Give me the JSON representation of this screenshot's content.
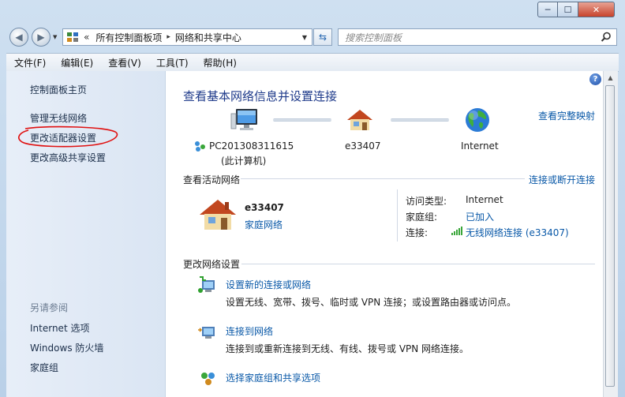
{
  "window": {
    "min_label": "─",
    "max_label": "☐",
    "close_label": "✕"
  },
  "nav": {
    "breadcrumb_prefix": "«",
    "crumb_1": "所有控制面板项",
    "crumb_sep": "▸",
    "crumb_2": "网络和共享中心",
    "search_placeholder": "搜索控制面板"
  },
  "menu": [
    "文件(F)",
    "编辑(E)",
    "查看(V)",
    "工具(T)",
    "帮助(H)"
  ],
  "sidebar": {
    "links": [
      "控制面板主页",
      "管理无线网络",
      "更改适配器设置",
      "更改高级共享设置"
    ],
    "see_also_heading": "另请参阅",
    "see_also": [
      "Internet 选项",
      "Windows 防火墙",
      "家庭组"
    ]
  },
  "main": {
    "title": "查看基本网络信息并设置连接",
    "full_map_link": "查看完整映射",
    "map": {
      "computer_name": "PC201308311615",
      "computer_sub": "(此计算机)",
      "network_name": "e33407",
      "internet": "Internet"
    },
    "active_heading": "查看活动网络",
    "connect_disconnect_link": "连接或断开连接",
    "active": {
      "network_name": "e33407",
      "network_type": "家庭网络",
      "access_label": "访问类型:",
      "access_value": "Internet",
      "homegroup_label": "家庭组:",
      "homegroup_value": "已加入",
      "connection_label": "连接:",
      "connection_value": "无线网络连接 (e33407)"
    },
    "change_heading": "更改网络设置",
    "tasks": [
      {
        "link": "设置新的连接或网络",
        "desc": "设置无线、宽带、拨号、临时或 VPN 连接；或设置路由器或访问点。"
      },
      {
        "link": "连接到网络",
        "desc": "连接到或重新连接到无线、有线、拨号或 VPN 网络连接。"
      },
      {
        "link": "选择家庭组和共享选项",
        "desc": ""
      }
    ]
  },
  "colors": {
    "link": "#0a59a8",
    "title": "#1e3a8a",
    "annotation": "#e01010",
    "signal": "#3aa63a"
  }
}
